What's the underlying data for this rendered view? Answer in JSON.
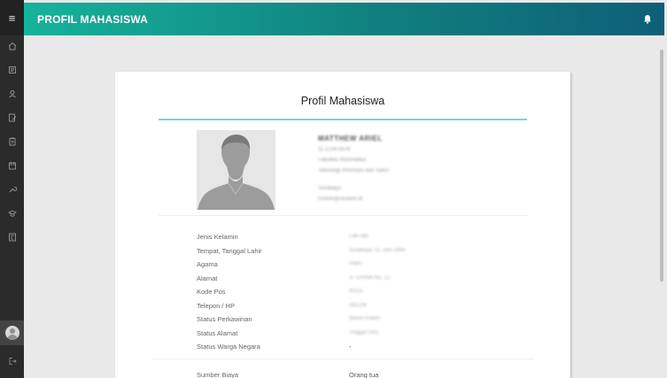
{
  "header": {
    "title": "PROFIL MAHASISWA",
    "menu_glyph": "≡"
  },
  "sidebar": {
    "items": [
      {
        "icon": "home-icon"
      },
      {
        "icon": "book-icon"
      },
      {
        "icon": "user-badge-icon"
      },
      {
        "icon": "document-edit-icon"
      },
      {
        "icon": "clipboard-icon"
      },
      {
        "icon": "calendar-icon"
      },
      {
        "icon": "tools-icon"
      },
      {
        "icon": "graduation-icon"
      },
      {
        "icon": "report-icon"
      }
    ],
    "logout_icon": "logout-icon"
  },
  "profile": {
    "card_title": "Profil Mahasiswa",
    "identity": {
      "name": "MATTHEW ARIEL",
      "nim": "11.1234.5678",
      "faculty": "Fakultas Informatika",
      "program": "Teknologi Informasi dan Sains",
      "city": "Surabaya",
      "email": "contoh@student.id"
    },
    "details": [
      {
        "label": "Jenis Kelamin",
        "value": "Laki-laki",
        "blurred": true
      },
      {
        "label": "Tempat, Tanggal Lahir",
        "value": "Surabaya, 01 Juni 1999",
        "blurred": true
      },
      {
        "label": "Agama",
        "value": "Islam",
        "blurred": true
      },
      {
        "label": "Alamat",
        "value": "Jl. Contoh No. 12",
        "blurred": true
      },
      {
        "label": "Kode Pos",
        "value": "60111",
        "blurred": true
      },
      {
        "label": "Telepon / HP",
        "value": "081234",
        "blurred": true
      },
      {
        "label": "Status Perkawinan",
        "value": "Belum Kawin",
        "blurred": true
      },
      {
        "label": "Status Alamat",
        "value": "Tinggal Ortu",
        "blurred": true
      },
      {
        "label": "Status Warga Negara",
        "value": "-",
        "blurred": false
      }
    ],
    "funding": {
      "label": "Sumber Biaya",
      "value": "Orang tua"
    }
  },
  "colors": {
    "header_start": "#16b39a",
    "header_end": "#0e5f78",
    "accent_rule": "#7fd4c9",
    "sidebar": "#2b2b2b"
  }
}
